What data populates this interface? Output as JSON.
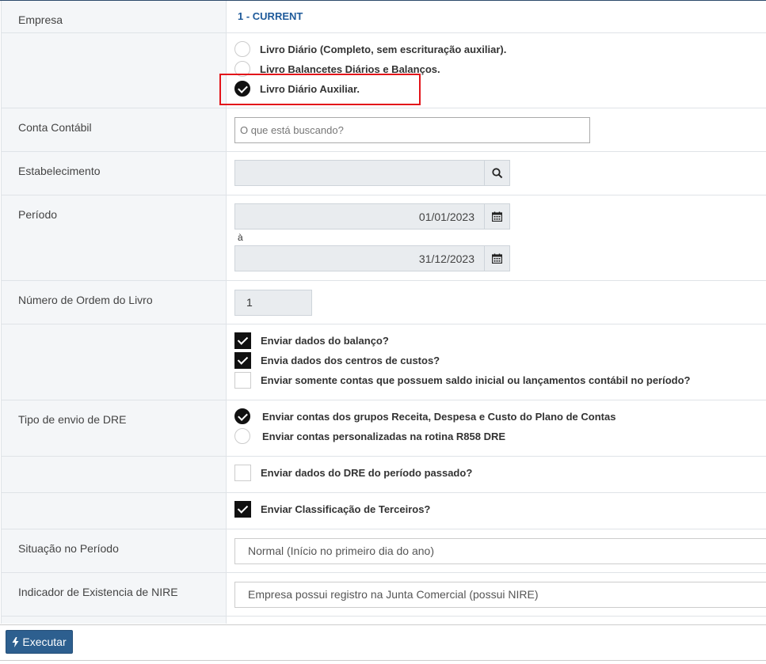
{
  "company": {
    "label": "Empresa",
    "value": "1 - CURRENT"
  },
  "book_type": {
    "options": [
      {
        "label": "Livro Diário (Completo, sem escrituração auxiliar).",
        "selected": false
      },
      {
        "label": "Livro Balancetes Diários e Balanços.",
        "selected": false
      },
      {
        "label": "Livro Diário Auxiliar.",
        "selected": true
      }
    ]
  },
  "account": {
    "label": "Conta Contábil",
    "placeholder": "O que está buscando?",
    "value": ""
  },
  "establishment": {
    "label": "Estabelecimento",
    "value": "",
    "icon": "search-icon"
  },
  "period": {
    "label": "Período",
    "start": "01/01/2023",
    "separator": "à",
    "end": "31/12/2023",
    "icon": "calendar-icon"
  },
  "book_order": {
    "label": "Número de Ordem do Livro",
    "value": "1"
  },
  "balance_options": [
    {
      "label": "Enviar dados do balanço?",
      "checked": true
    },
    {
      "label": "Envia dados dos centros de custos?",
      "checked": true
    },
    {
      "label": "Enviar somente contas que possuem saldo inicial ou lançamentos contábil no período?",
      "checked": false
    }
  ],
  "dre_type": {
    "label": "Tipo de envio de DRE",
    "options": [
      {
        "label": "Enviar contas dos grupos Receita, Despesa e Custo do Plano de Contas",
        "selected": true
      },
      {
        "label": "Enviar contas personalizadas na rotina R858 DRE",
        "selected": false
      }
    ]
  },
  "dre_previous": {
    "label": "Enviar dados do DRE do período passado?",
    "checked": false
  },
  "third_party": {
    "label": "Enviar Classificação de Terceiros?",
    "checked": true
  },
  "situation": {
    "label": "Situação no Período",
    "value": "Normal (Início no primeiro dia do ano)"
  },
  "nire": {
    "label": "Indicador de Existencia de NIRE",
    "value": "Empresa possui registro na Junta Comercial (possui NIRE)"
  },
  "footer": {
    "execute_label": "Executar"
  },
  "colors": {
    "accent": "#2d5f8f",
    "highlight": "#e3141a",
    "company_text": "#1e5a9a"
  }
}
